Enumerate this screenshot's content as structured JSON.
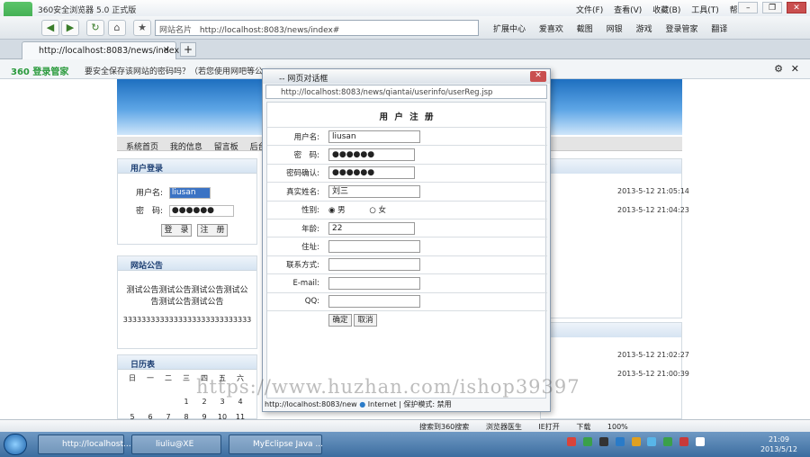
{
  "window": {
    "title": "360安全浏览器 5.0 正式版",
    "menus": [
      "文件(F)",
      "查看(V)",
      "收藏(B)",
      "工具(T)",
      "帮助(H)"
    ],
    "login_badge": "请登录"
  },
  "address_bar": {
    "label": "网站名片",
    "url": "http://localhost:8083/news/index#"
  },
  "toolbar": {
    "items": [
      "扩展中心",
      "爱喜欢",
      "截图",
      "网银",
      "游戏",
      "登录管家",
      "翻译"
    ]
  },
  "tabs": [
    {
      "label": "http://localhost:8083/news/index"
    }
  ],
  "password_bar": {
    "brand": "360 登录管家",
    "message": "要安全保存该网站的密码吗？（若您使用网吧等公"
  },
  "site": {
    "menu": [
      "系统首页",
      "我的信息",
      "留言板",
      "后台管理"
    ],
    "login_panel": {
      "title": "用户登录",
      "username_label": "用户名:",
      "username_value": "liusan",
      "password_label": "密　码:",
      "password_value": "●●●●●●",
      "login_btn": "登　录",
      "register_btn": "注　册"
    },
    "notice_panel": {
      "title": "网站公告",
      "text": "测试公告测试公告测试公告测试公告测试公告测试公告",
      "numbers": "3333333333333333333333333333"
    },
    "calendar_panel": {
      "title": "日历表",
      "weekdays": [
        "日",
        "一",
        "二",
        "三",
        "四",
        "五",
        "六"
      ],
      "rows": [
        [
          "",
          "",
          "",
          "1",
          "2",
          "3",
          "4"
        ],
        [
          "5",
          "6",
          "7",
          "8",
          "9",
          "10",
          "11"
        ]
      ]
    },
    "dates": [
      "2013-5-12 21:05:14",
      "2013-5-12 21:04:23",
      "2013-5-12 21:02:27",
      "2013-5-12 21:00:39"
    ]
  },
  "dialog": {
    "title": "-- 网页对话框",
    "url": "http://localhost:8083/news/qiantai/userinfo/userReg.jsp",
    "form_title": "用 户 注 册",
    "fields": [
      {
        "label": "用户名:",
        "value": "liusan"
      },
      {
        "label": "密　码:",
        "value": "●●●●●●"
      },
      {
        "label": "密码确认:",
        "value": "●●●●●●"
      },
      {
        "label": "真实姓名:",
        "value": "刘三"
      },
      {
        "label": "性别:",
        "value": ""
      },
      {
        "label": "年龄:",
        "value": "22"
      },
      {
        "label": "住址:",
        "value": ""
      },
      {
        "label": "联系方式:",
        "value": ""
      },
      {
        "label": "E-mail:",
        "value": ""
      },
      {
        "label": "QQ:",
        "value": ""
      }
    ],
    "gender_options": [
      "男",
      "女"
    ],
    "submit_btn": "确定",
    "cancel_btn": "取消",
    "status": "http://localhost:8083/new",
    "zone": "Internet | 保护模式: 禁用"
  },
  "status_bar": {
    "items": [
      "搜索到360搜索",
      "浏览器医生",
      "IE打开",
      "下载",
      "100%"
    ]
  },
  "taskbar": {
    "tasks": [
      "http://localhost...",
      "liuliu@XE",
      "MyEclipse Java ..."
    ],
    "time": "21:09",
    "date": "2013/5/12"
  },
  "watermark": "https://www.huzhan.com/ishop39397"
}
